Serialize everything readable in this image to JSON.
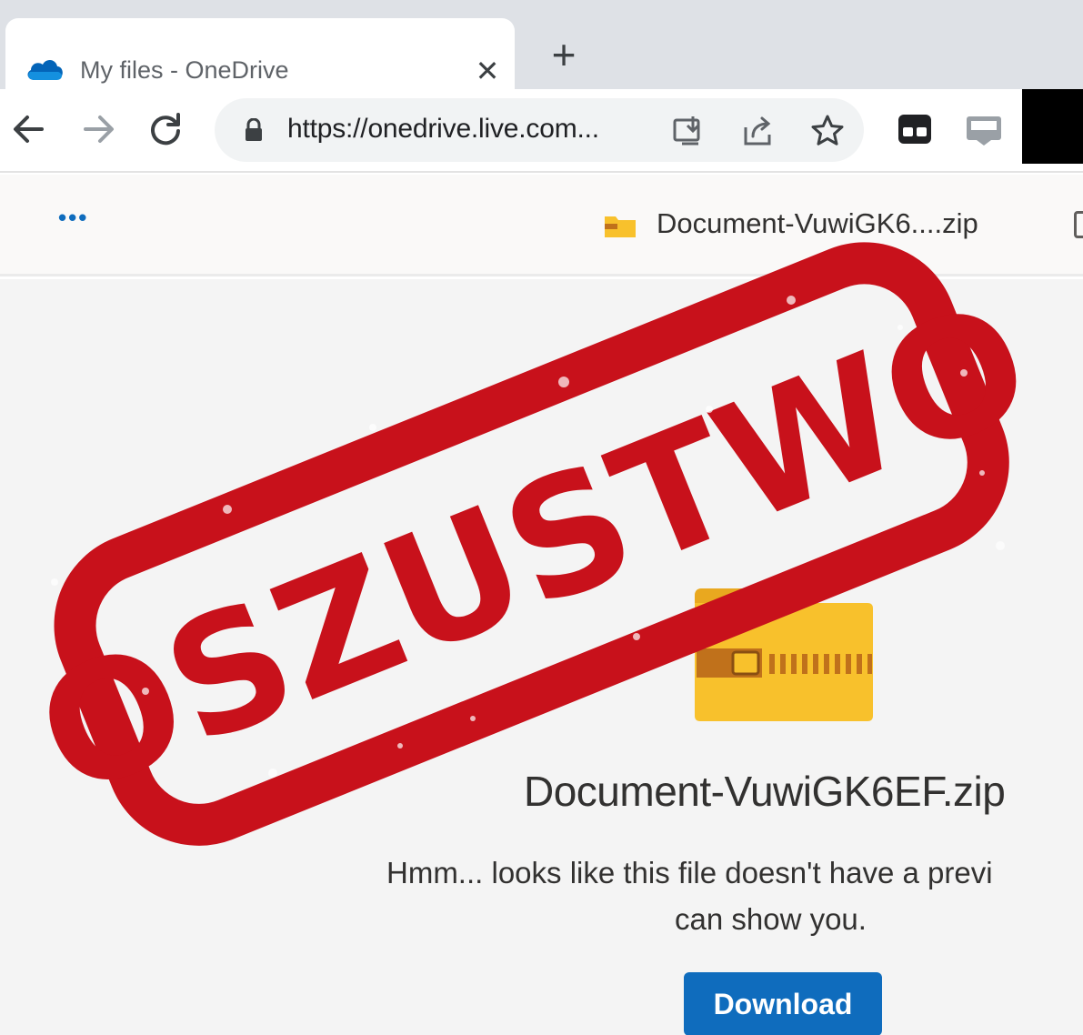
{
  "browser": {
    "tab": {
      "title": "My files - OneDrive",
      "close_icon": "close-icon",
      "cloud_icon": "onedrive-cloud-icon"
    },
    "new_tab_icon": "plus-icon",
    "toolbar": {
      "back_icon": "arrow-left-icon",
      "forward_icon": "arrow-right-icon",
      "reload_icon": "reload-icon",
      "url": "https://onedrive.live.com...",
      "lock_icon": "lock-icon",
      "install_icon": "install-app-icon",
      "share_icon": "share-icon",
      "bookmark_icon": "star-icon",
      "extensions": [
        "extension-icon",
        "extension-icon-2"
      ]
    }
  },
  "onedrive": {
    "header": {
      "more_label": "•••",
      "file_name": "Document-VuwiGK6....zip"
    },
    "preview": {
      "file_name": "Document-VuwiGK6EF.zip",
      "message_line1": "Hmm... looks like this file doesn't have a previ",
      "message_line2": "can show you.",
      "download_label": "Download"
    }
  },
  "stamp": {
    "text": "OSZUSTWO",
    "color": "#c8111b"
  },
  "colors": {
    "accent": "#0f6cbd",
    "tab_strip": "#dee1e6",
    "zip_yellow": "#f8c12c"
  }
}
